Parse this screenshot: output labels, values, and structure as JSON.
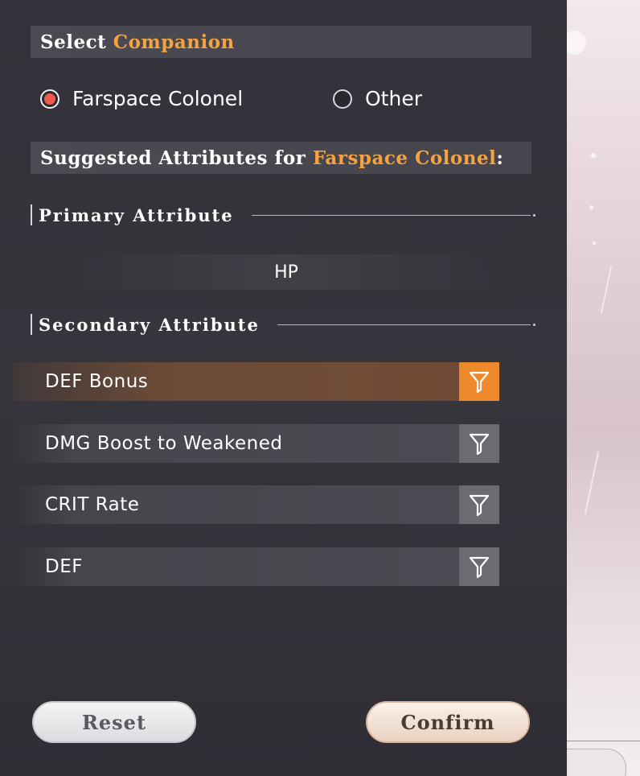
{
  "select_companion": {
    "prefix": "Select",
    "accent": "Companion",
    "options": [
      {
        "label": "Farspace Colonel",
        "selected": true
      },
      {
        "label": "Other",
        "selected": false
      }
    ]
  },
  "suggested": {
    "prefix": "Suggested Attributes for",
    "accent": "Farspace Colonel",
    "suffix": ":"
  },
  "primary": {
    "heading": "Primary Attribute",
    "value": "HP"
  },
  "secondary": {
    "heading": "Secondary Attribute",
    "items": [
      {
        "label": "DEF Bonus",
        "active": true,
        "icon": "filter-icon"
      },
      {
        "label": "DMG Boost to Weakened",
        "active": false,
        "icon": "filter-icon"
      },
      {
        "label": "CRIT Rate",
        "active": false,
        "icon": "filter-icon"
      },
      {
        "label": "DEF",
        "active": false,
        "icon": "filter-icon"
      }
    ]
  },
  "actions": {
    "reset_label": "Reset",
    "confirm_label": "Confirm"
  },
  "colors": {
    "accent": "#f4a340",
    "filter_active": "#ee8a2c",
    "radio_selected": "#ee5b4d"
  }
}
